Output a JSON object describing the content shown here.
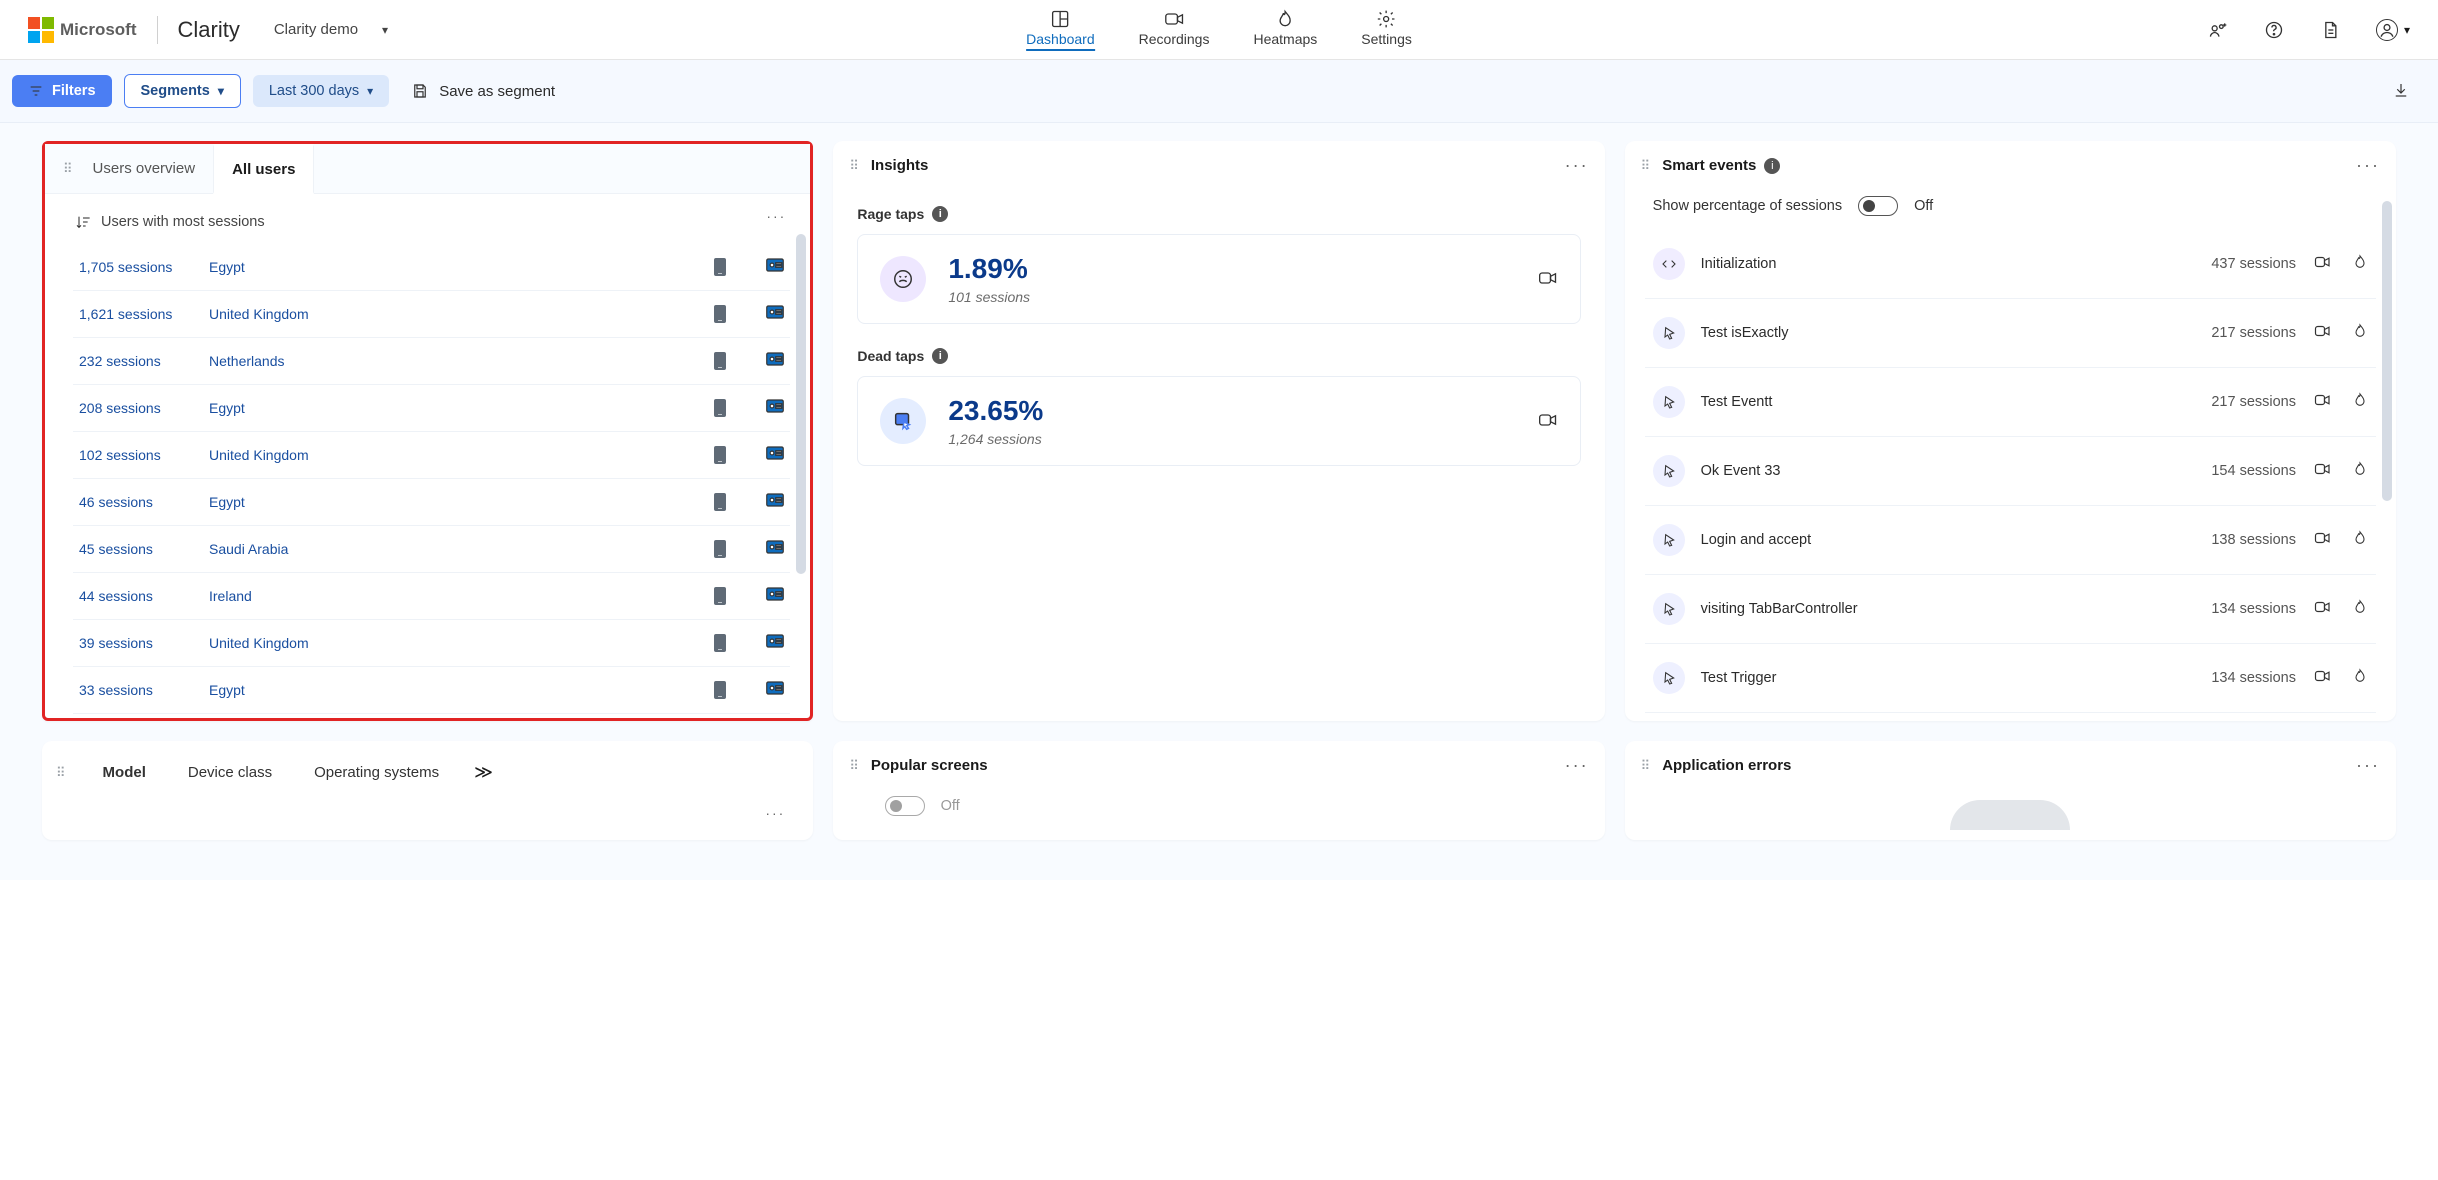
{
  "header": {
    "brand": "Microsoft",
    "product": "Clarity",
    "project": "Clarity demo",
    "nav": {
      "dashboard": "Dashboard",
      "recordings": "Recordings",
      "heatmaps": "Heatmaps",
      "settings": "Settings"
    }
  },
  "toolbar": {
    "filters": "Filters",
    "segments": "Segments",
    "daterange": "Last 300 days",
    "save_segment": "Save as segment"
  },
  "users_card": {
    "tab_overview": "Users overview",
    "tab_all": "All users",
    "subtitle": "Users with most sessions",
    "rows": [
      {
        "sessions": "1,705 sessions",
        "country": "Egypt"
      },
      {
        "sessions": "1,621 sessions",
        "country": "United Kingdom"
      },
      {
        "sessions": "232 sessions",
        "country": "Netherlands"
      },
      {
        "sessions": "208 sessions",
        "country": "Egypt"
      },
      {
        "sessions": "102 sessions",
        "country": "United Kingdom"
      },
      {
        "sessions": "46 sessions",
        "country": "Egypt"
      },
      {
        "sessions": "45 sessions",
        "country": "Saudi Arabia"
      },
      {
        "sessions": "44 sessions",
        "country": "Ireland"
      },
      {
        "sessions": "39 sessions",
        "country": "United Kingdom"
      },
      {
        "sessions": "33 sessions",
        "country": "Egypt"
      }
    ]
  },
  "insights_card": {
    "title": "Insights",
    "rage": {
      "label": "Rage taps",
      "value": "1.89%",
      "sub": "101 sessions"
    },
    "dead": {
      "label": "Dead taps",
      "value": "23.65%",
      "sub": "1,264 sessions"
    }
  },
  "smart_events": {
    "title": "Smart events",
    "toggle_label": "Show percentage of sessions",
    "toggle_state": "Off",
    "rows": [
      {
        "icon": "code",
        "name": "Initialization",
        "count": "437 sessions"
      },
      {
        "icon": "mouse",
        "name": "Test isExactly",
        "count": "217 sessions"
      },
      {
        "icon": "mouse",
        "name": "Test Eventt",
        "count": "217 sessions"
      },
      {
        "icon": "mouse",
        "name": "Ok Event 33",
        "count": "154 sessions"
      },
      {
        "icon": "mouse",
        "name": "Login and accept",
        "count": "138 sessions"
      },
      {
        "icon": "mouse",
        "name": "visiting TabBarController",
        "count": "134 sessions"
      },
      {
        "icon": "mouse",
        "name": "Test Trigger",
        "count": "134 sessions"
      }
    ]
  },
  "model_card": {
    "tab_model": "Model",
    "tab_device": "Device class",
    "tab_os": "Operating systems"
  },
  "popular_card": {
    "title": "Popular screens",
    "toggle_state": "Off"
  },
  "errors_card": {
    "title": "Application errors"
  }
}
